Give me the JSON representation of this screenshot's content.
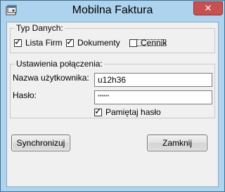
{
  "window": {
    "title": "Mobilna Faktura",
    "close_glyph": "✕",
    "app_icon": "app-icon"
  },
  "typ_danych": {
    "title": "Typ Danych:",
    "items": [
      {
        "label": "Lista Firm",
        "checked": true
      },
      {
        "label": "Dokumenty",
        "checked": true
      },
      {
        "label": "Cennik",
        "checked": false
      }
    ]
  },
  "ustawienia": {
    "title": "Ustawienia połączenia:",
    "username_label": "Nazwa użytkownika:",
    "username_value": "u12h36",
    "password_label": "Hasło:",
    "password_value": "******",
    "remember_label": "Pamiętaj hasło",
    "remember_checked": true
  },
  "buttons": {
    "sync_label": "Synchronizuj",
    "close_label": "Zamknij"
  },
  "colors": {
    "frame": "#aed3ee",
    "close_button": "#c75050",
    "client": "#f0f0f0"
  }
}
